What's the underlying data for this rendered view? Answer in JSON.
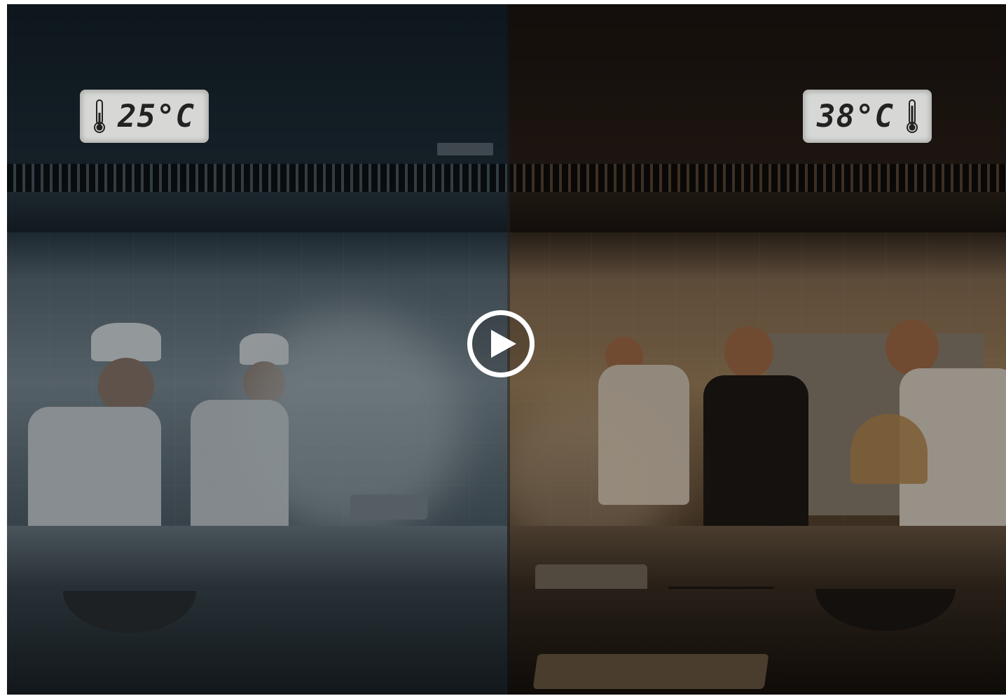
{
  "video": {
    "left_temperature": "25°C",
    "right_temperature": "38°C"
  },
  "icons": {
    "play": "play-icon",
    "thermometer": "thermometer-icon"
  },
  "colors": {
    "cool_tone": "#5c6d78",
    "warm_tone": "#a3855f",
    "play_button": "#ffffff"
  }
}
